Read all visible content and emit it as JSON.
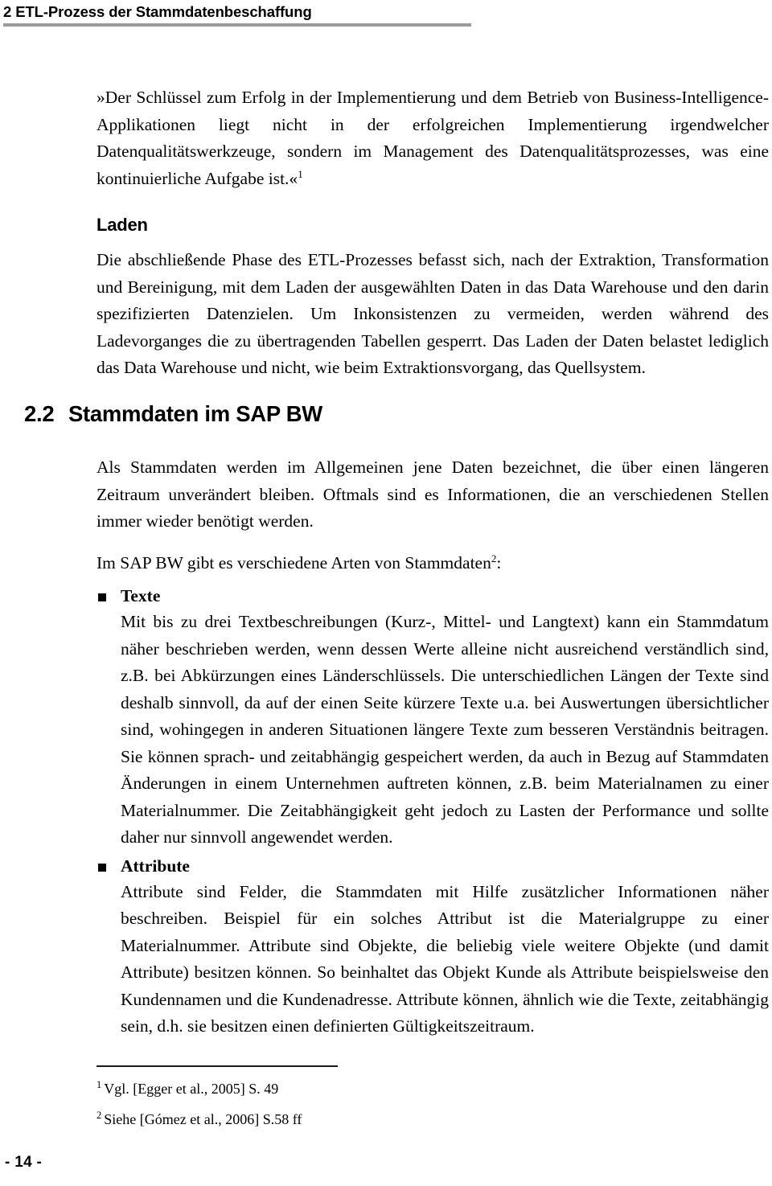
{
  "document": {
    "running_header": "2 ETL-Prozess der Stammdatenbeschaffung",
    "page_number": "- 14 -"
  },
  "quote": {
    "text": "»Der Schlüssel zum Erfolg in der Implementierung und dem Betrieb von Business-Intelligence-Applikationen liegt nicht in der erfolgreichen Implementierung irgendwelcher Datenqualitätswerkzeuge, sondern im Management des Datenqualitätsprozesses, was eine kontinuierliche Aufgabe ist.«",
    "footnote_marker": "1"
  },
  "laden": {
    "heading": "Laden",
    "paragraph": "Die abschließende Phase des ETL-Prozesses befasst sich, nach der Extraktion, Transformation und Bereinigung, mit dem Laden der ausgewählten Daten in das Data Warehouse und den darin spezifizierten Datenzielen. Um Inkonsistenzen zu vermeiden, werden während des Ladevorganges die zu übertragenden Tabellen gesperrt. Das Laden der Daten belastet lediglich das Data Warehouse und nicht, wie beim Extraktionsvorgang, das Quellsystem."
  },
  "section": {
    "number": "2.2",
    "title": "Stammdaten im SAP BW",
    "intro_paragraph": "Als Stammdaten werden im Allgemeinen jene Daten bezeichnet, die über einen längeren Zeitraum unverändert bleiben. Oftmals sind es Informationen, die an verschiedenen Stellen immer wieder benötigt werden.",
    "lead_in_prefix": "Im SAP BW gibt es verschiedene Arten von Stammdaten",
    "lead_in_marker": "2",
    "lead_in_suffix": ":",
    "bullets": [
      {
        "label": "Texte",
        "text": "Mit bis zu drei Textbeschreibungen (Kurz-, Mittel- und Langtext) kann ein Stammdatum näher beschrieben werden, wenn dessen Werte alleine nicht ausreichend verständlich sind, z.B. bei Abkürzungen eines Länderschlüssels. Die unterschiedlichen Längen der Texte sind deshalb sinnvoll, da auf der einen Seite kürzere Texte u.a. bei Auswertungen übersichtlicher sind, wohingegen in anderen Situationen längere Texte zum besseren Verständnis beitragen. Sie können sprach- und zeitabhängig gespeichert werden, da auch in Bezug auf Stammdaten Änderungen in einem Unternehmen auftreten können, z.B. beim Materialnamen zu einer Materialnummer. Die Zeitabhängigkeit geht jedoch zu Lasten der Performance und sollte daher nur sinnvoll angewendet werden."
      },
      {
        "label": "Attribute",
        "text": "Attribute sind Felder, die Stammdaten mit Hilfe zusätzlicher Informationen näher beschreiben. Beispiel für ein solches Attribut ist die Materialgruppe zu einer Materialnummer. Attribute sind Objekte, die beliebig viele weitere Objekte (und damit Attribute) besitzen können. So beinhaltet das Objekt Kunde als Attribute beispielsweise den Kundennamen und die Kundenadresse. Attribute können, ähnlich wie die Texte, zeitabhängig sein, d.h. sie besitzen einen definierten Gültigkeitszeitraum."
      }
    ]
  },
  "footnotes": [
    {
      "marker": "1",
      "text": "Vgl. [Egger et al., 2005] S. 49"
    },
    {
      "marker": "2",
      "text": "Siehe [Gómez et al., 2006] S.58 ff"
    }
  ]
}
